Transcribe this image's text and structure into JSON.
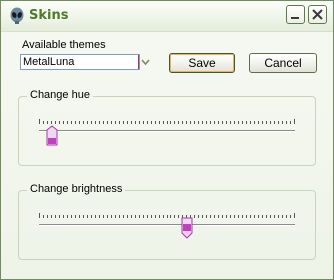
{
  "window": {
    "title": "Skins",
    "icon": "alien-icon",
    "buttons": [
      "minimize-icon",
      "close-icon"
    ]
  },
  "themes": {
    "label": "Available themes",
    "selected": "MetalLuna"
  },
  "actions": {
    "save_label": "Save",
    "cancel_label": "Cancel"
  },
  "hue": {
    "label": "Change hue",
    "value": 0.03
  },
  "brightness": {
    "label": "Change brightness",
    "value": 0.58
  },
  "colors": {
    "title": "#4e7a2a",
    "thumb": "#c040c0",
    "focus": "#e8b464"
  }
}
